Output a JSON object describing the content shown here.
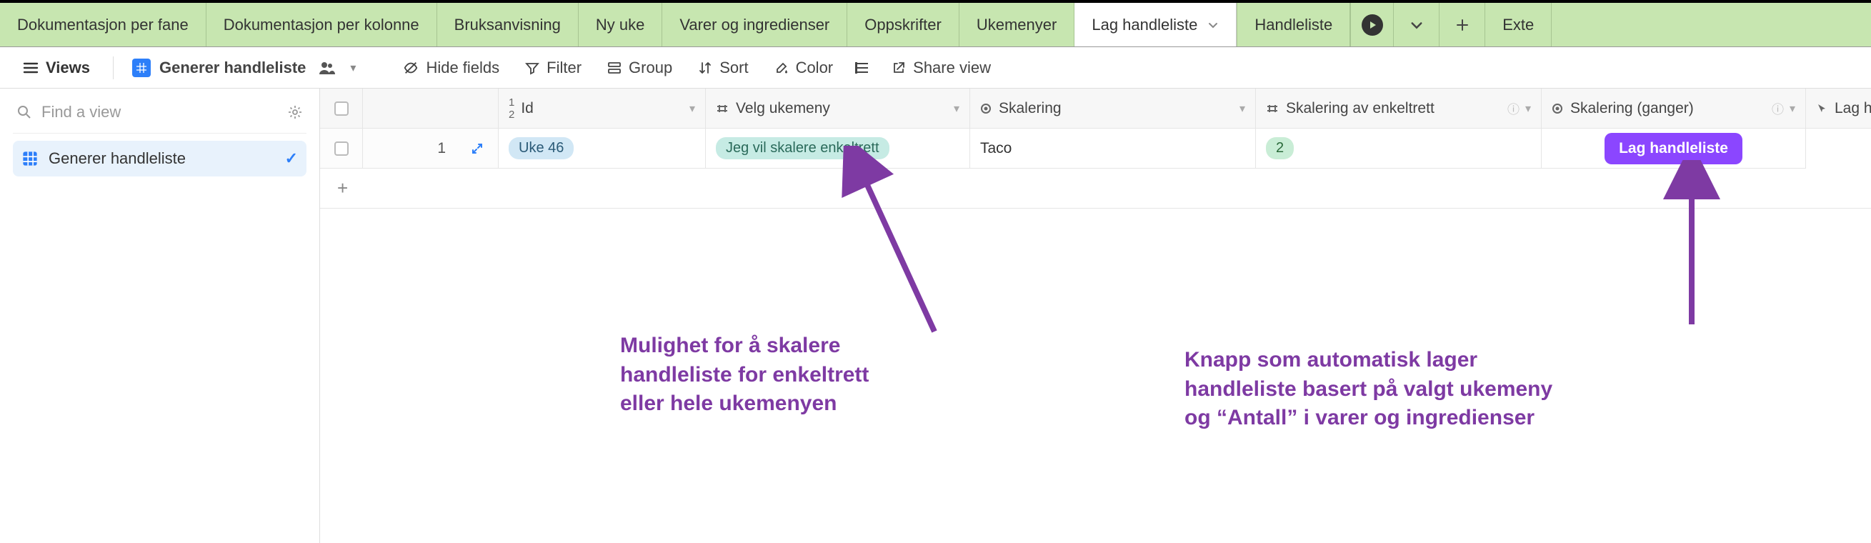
{
  "tabs": [
    "Dokumentasjon per fane",
    "Dokumentasjon per kolonne",
    "Bruksanvisning",
    "Ny uke",
    "Varer og ingredienser",
    "Oppskrifter",
    "Ukemenyer",
    "Lag handleliste",
    "Handleliste",
    "Extе"
  ],
  "active_tab_index": 7,
  "toolbar": {
    "views": "Views",
    "view_name": "Generer handleliste",
    "hide_fields": "Hide fields",
    "filter": "Filter",
    "group": "Group",
    "sort": "Sort",
    "color": "Color",
    "share": "Share view"
  },
  "sidebar": {
    "find_placeholder": "Find a view",
    "views": [
      {
        "label": "Generer handleliste",
        "active": true
      }
    ]
  },
  "columns": {
    "id": "Id",
    "velg_ukemeny": "Velg ukemeny",
    "skalering": "Skalering",
    "skalering_enkeltrett": "Skalering av enkeltrett",
    "skalering_ganger": "Skalering (ganger)",
    "lag_handleliste": "Lag handleliste"
  },
  "rows": [
    {
      "id": "1",
      "velg_ukemeny": "Uke 46",
      "skalering": "Jeg vil skalere enkeltrett",
      "skalering_enkeltrett": "Taco",
      "skalering_ganger": "2",
      "button_label": "Lag handleliste"
    }
  ],
  "annotations": {
    "left": "Mulighet for å skalere\nhandleliste for enkeltrett\neller hele ukemenyen",
    "right": "Knapp som automatisk lager\nhandleliste basert på valgt ukemeny\nog “Antall” i varer og ingredienser"
  },
  "colors": {
    "tab_green": "#c7e6b0",
    "accent_blue": "#2d7ff9",
    "button_purple": "#8b46ff",
    "annotation_purple": "#7e3aa3"
  }
}
